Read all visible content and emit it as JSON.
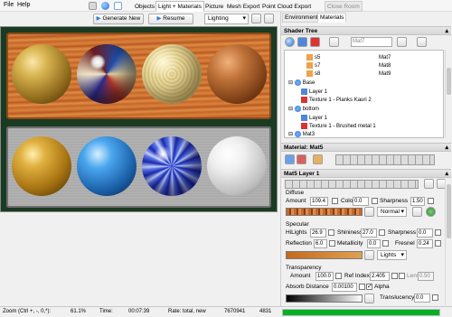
{
  "menu": {
    "file": "File",
    "help": "Help"
  },
  "tabs": [
    "Objects",
    "Light + Materials",
    "Picture",
    "Mesh Export",
    "Point Cloud Export"
  ],
  "close_room": "Close Room",
  "toolbar": {
    "generate": "Generate New",
    "resume": "Resume",
    "lighting": "Lighting"
  },
  "right_tabs": [
    "Environment",
    "Materials"
  ],
  "shader_tree": {
    "title": "Shader Tree",
    "mat_input": "Mat7",
    "rows": [
      {
        "name": "s5",
        "mat": "Mat7"
      },
      {
        "name": "s7",
        "mat": "Mat8"
      },
      {
        "name": "s8",
        "mat": "Mat9"
      },
      {
        "name": "Base"
      },
      {
        "name": "Layer 1"
      },
      {
        "name": "Texture 1 - Planks Kauri 2"
      },
      {
        "name": "bottom"
      },
      {
        "name": "Layer 1"
      },
      {
        "name": "Texture 1 - Brushed metal 1"
      },
      {
        "name": "Mat3"
      }
    ]
  },
  "material_head": "Material: Mat5",
  "layer_head": "Mat5 Layer 1",
  "diffuse": {
    "title": "Diffuse",
    "amount_label": "Amount",
    "amount": "109.4",
    "color_label": "Color",
    "color": "0.0",
    "sharpness_label": "Sharpness",
    "sharpness": "1.50",
    "mode": "Normal"
  },
  "specular": {
    "title": "Specular",
    "hilights_label": "HiLights",
    "hilights": "26.9",
    "shininess_label": "Shininess",
    "shininess": "27.0",
    "sharpness_label": "Sharpness",
    "sharpness": "0.0",
    "reflection_label": "Reflection",
    "reflection": "6.0",
    "metallicity_label": "Metallicity",
    "metallicity": "0.0",
    "fresnel_label": "Fresnel",
    "fresnel": "0.24",
    "mode": "Lights"
  },
  "transparency": {
    "title": "Transparency",
    "amount_label": "Amount",
    "amount": "100.0",
    "refindex_label": "Ref Index",
    "refindex": "2.405",
    "lens_label": "Lens",
    "lens": "0.50",
    "absorb_label": "Absorb Distance",
    "absorb": "0.00100",
    "alpha_label": "Alpha",
    "translucency_label": "Translucency",
    "translucency": "0.0"
  },
  "status": {
    "zoom_label": "Zoom (Ctrl +, -, 0,*):",
    "zoom": "61.1%",
    "time_label": "Time:",
    "time": "00:07:39",
    "rate_label": "Rate: total, new",
    "rate": "7670941",
    "count": "4831",
    "progress": 1.0
  },
  "colors": {
    "progress": "#06b025",
    "accent": "#3a7bd5"
  }
}
